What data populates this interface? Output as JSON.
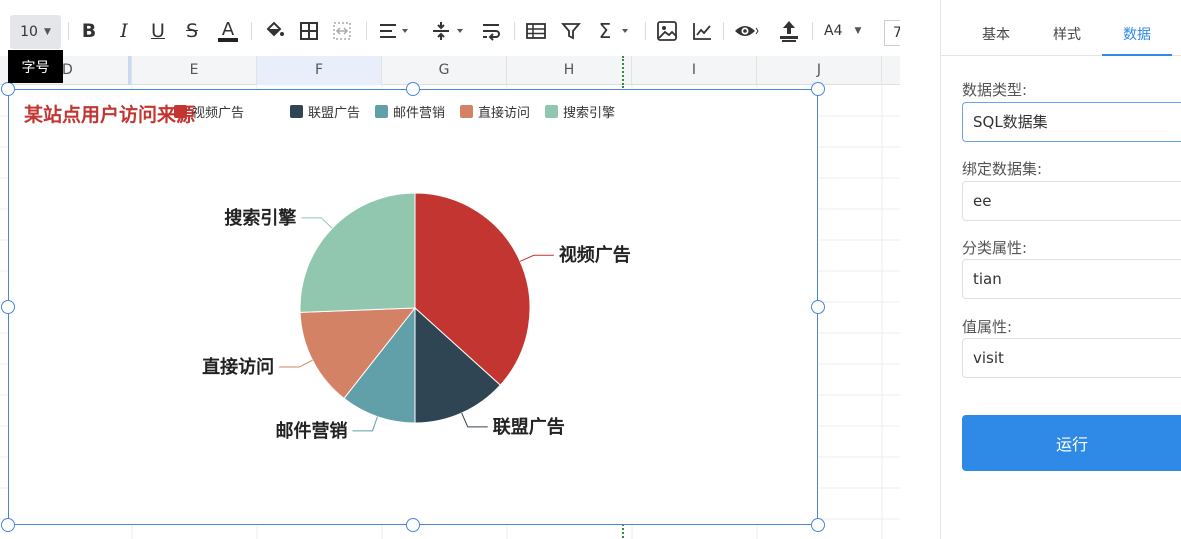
{
  "toolbar": {
    "font_size": "10",
    "font_size_tooltip": "字号",
    "paper_size": "A4",
    "zoom": "7"
  },
  "sheet": {
    "columns": [
      {
        "label": "D",
        "selected": false
      },
      {
        "label": "E",
        "selected": false
      },
      {
        "label": "F",
        "selected": true
      },
      {
        "label": "G",
        "selected": false
      },
      {
        "label": "H",
        "selected": false
      },
      {
        "label": "I",
        "selected": false
      },
      {
        "label": "J",
        "selected": false
      }
    ]
  },
  "chart_data": {
    "type": "pie",
    "title": "某站点用户访问来源",
    "title_color": "#c23531",
    "legend_position": "top",
    "slices": [
      {
        "name": "视频广告",
        "value": 36.7,
        "color": "#c23531"
      },
      {
        "name": "联盟广告",
        "value": 13.3,
        "color": "#2f4554"
      },
      {
        "name": "邮件营销",
        "value": 10.6,
        "color": "#61a0a8"
      },
      {
        "name": "直接访问",
        "value": 13.8,
        "color": "#d48265"
      },
      {
        "name": "搜索引擎",
        "value": 25.6,
        "color": "#91c7ae"
      }
    ]
  },
  "panel": {
    "tabs": [
      "基本",
      "样式",
      "数据"
    ],
    "active_tab": 2,
    "fields": [
      {
        "label": "数据类型:",
        "value": "SQL数据集"
      },
      {
        "label": "绑定数据集:",
        "value": "ee"
      },
      {
        "label": "分类属性:",
        "value": "tian"
      },
      {
        "label": "值属性:",
        "value": "visit"
      }
    ],
    "run_label": "运行"
  },
  "colors": {
    "accent": "#2f89e6",
    "selection_border": "#4a86d8",
    "page_break": "#2f8f3f"
  }
}
